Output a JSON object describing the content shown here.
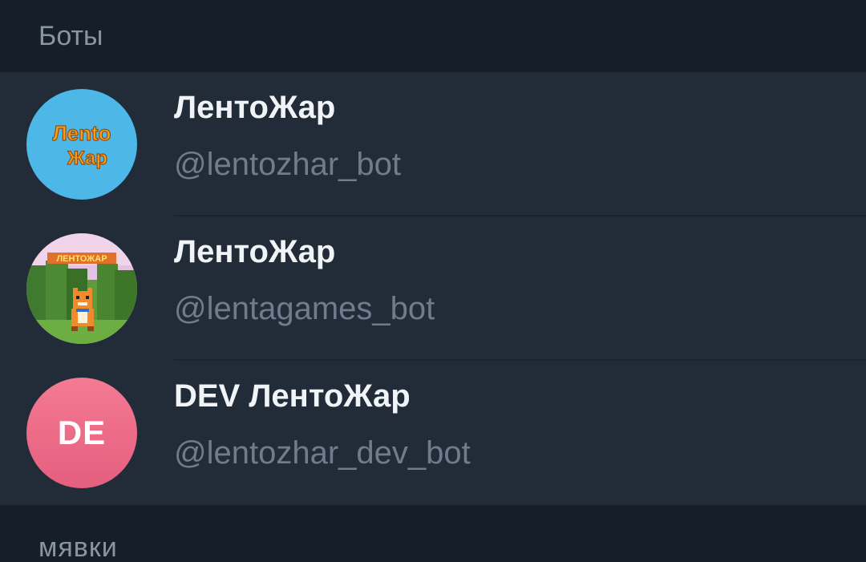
{
  "sections": {
    "bots_label": "Боты",
    "next_label": "мявки"
  },
  "bots": [
    {
      "name": "ЛентоЖар",
      "username": "@lentozhar_bot",
      "avatar": {
        "type": "logo-text",
        "line1": "Лento",
        "line2": "Жар",
        "bg": "#4db8e8"
      }
    },
    {
      "name": "ЛентоЖар",
      "username": "@lentagames_bot",
      "avatar": {
        "type": "pixel-art",
        "caption": "ЛЕНТОЖАР"
      }
    },
    {
      "name": "DEV ЛентоЖар",
      "username": "@lentozhar_dev_bot",
      "avatar": {
        "type": "initials",
        "initials": "DE",
        "bg": "#e8668a"
      }
    }
  ]
}
